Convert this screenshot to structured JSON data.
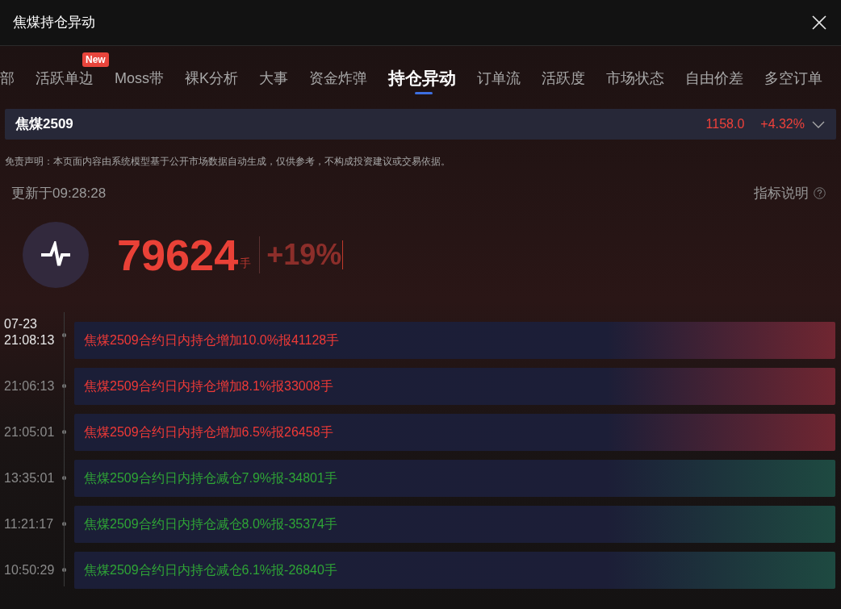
{
  "window": {
    "title": "焦煤持仓异动"
  },
  "tabs": [
    {
      "label": "部",
      "selected": false
    },
    {
      "label": "活跃单边",
      "selected": false,
      "badge": "New"
    },
    {
      "label": "Moss带",
      "selected": false
    },
    {
      "label": "裸K分析",
      "selected": false
    },
    {
      "label": "大事",
      "selected": false
    },
    {
      "label": "资金炸弹",
      "selected": false
    },
    {
      "label": "持仓异动",
      "selected": true
    },
    {
      "label": "订单流",
      "selected": false
    },
    {
      "label": "活跃度",
      "selected": false
    },
    {
      "label": "市场状态",
      "selected": false
    },
    {
      "label": "自由价差",
      "selected": false
    },
    {
      "label": "多空订单",
      "selected": false
    }
  ],
  "contract": {
    "name": "焦煤2509",
    "price": "1158.0",
    "change": "+4.32%"
  },
  "disclaimer": "免责声明：本页面内容由系统模型基于公开市场数据自动生成，仅供参考，不构成投资建议或交易依据。",
  "updated": "更新于09:28:28",
  "help_link": "指标说明",
  "summary": {
    "value": "79624",
    "unit": "手",
    "change": "+19%"
  },
  "events": [
    {
      "date": "07-23",
      "time": "21:08:13",
      "text": "焦煤2509合约日内持仓增加10.0%报41128手",
      "kind": "up",
      "highlighted": true
    },
    {
      "time": "21:06:13",
      "text": "焦煤2509合约日内持仓增加8.1%报33008手",
      "kind": "up",
      "highlighted": false
    },
    {
      "time": "21:05:01",
      "text": "焦煤2509合约日内持仓增加6.5%报26458手",
      "kind": "up",
      "highlighted": false
    },
    {
      "time": "13:35:01",
      "text": "焦煤2509合约日内持仓减仓7.9%报-34801手",
      "kind": "down",
      "highlighted": false
    },
    {
      "time": "11:21:17",
      "text": "焦煤2509合约日内持仓减仓8.0%报-35374手",
      "kind": "down",
      "highlighted": false
    },
    {
      "time": "10:50:29",
      "text": "焦煤2509合约日内持仓减仓6.1%报-26840手",
      "kind": "down",
      "highlighted": false
    }
  ]
}
